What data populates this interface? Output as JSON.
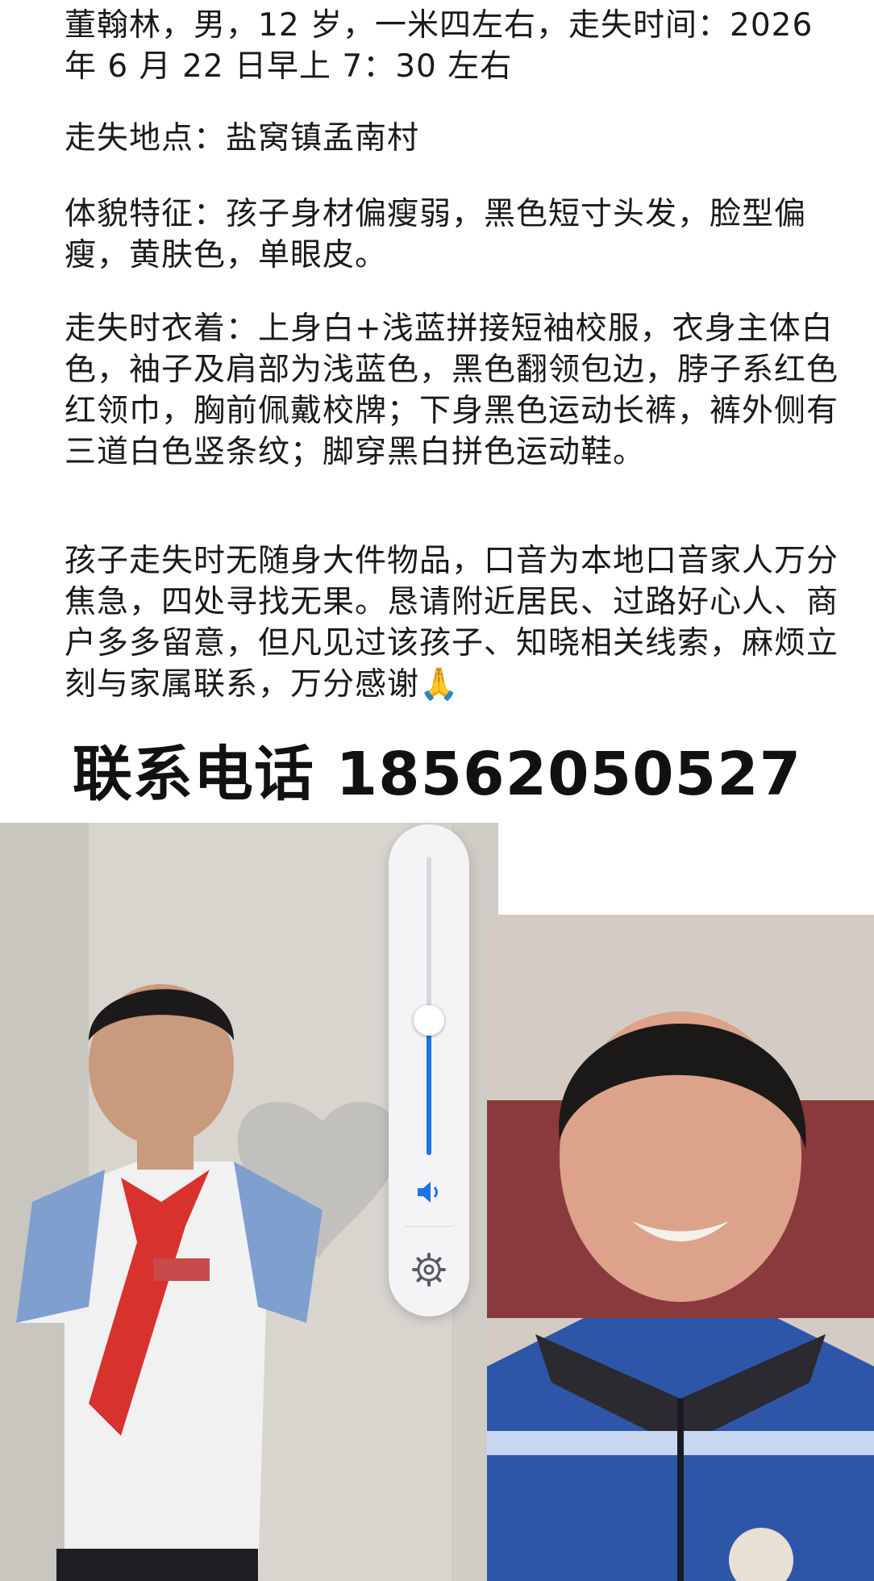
{
  "notice": {
    "paragraphs": [
      "董翰林，男，12 岁，一米四左右，走失时间：2026 年 6 月 22 日早上 7：30 左右",
      "走失地点：盐窝镇孟南村",
      "体貌特征：孩子身材偏瘦弱，黑色短寸头发，脸型偏瘦，黄肤色，单眼皮。",
      "走失时衣着：上身白+浅蓝拼接短袖校服，衣身主体白色，袖子及肩部为浅蓝色，黑色翻领包边，脖子系红色红领巾，胸前佩戴校牌；下身黑色运动长裤，裤外侧有三道白色竖条纹；脚穿黑白拼色运动鞋。",
      "孩子走失时无随身大件物品，口音为本地口音家人万分焦急，四处寻找无果。恳请附近居民、过路好心人、商户多多留意，但凡见过该孩子、知晓相关线索，麻烦立刻与家属联系，万分感谢"
    ],
    "emoji": "🙏",
    "phone_line": "联系电话 18562050527"
  },
  "volume_overlay": {
    "level": 0.45,
    "speaker_icon": "speaker-icon",
    "settings_icon": "gear-icon",
    "accent_color": "#1f73e6"
  },
  "colors": {
    "text": "#1a1a1a",
    "background": "#ffffff"
  }
}
